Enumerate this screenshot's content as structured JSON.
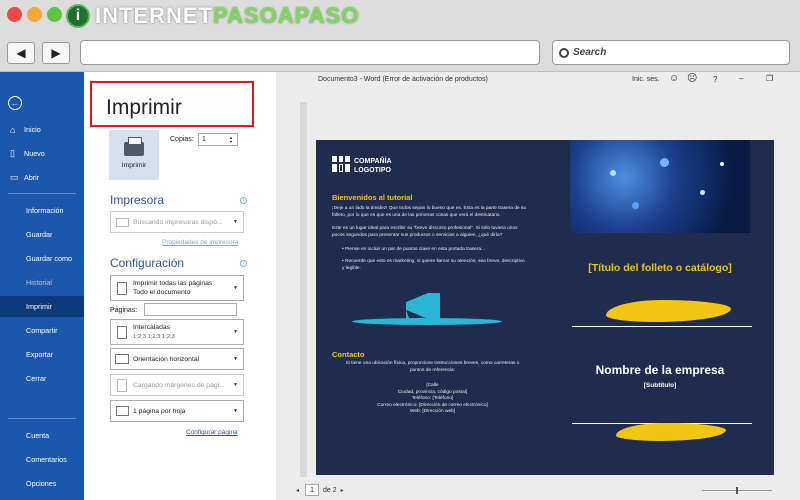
{
  "browser": {
    "logo_left": "INTERNET",
    "logo_right": "PASOAPASO",
    "back_icon": "arrow-left-icon",
    "forward_icon": "arrow-right-icon",
    "search_placeholder": "Search"
  },
  "window": {
    "title": "Documento3  -  Word (Error de activación de productos)",
    "signin": "Inic. ses.",
    "smile_icon": "☺",
    "frown_icon": "☹",
    "help": "?",
    "minimize": "–",
    "restore": "❐"
  },
  "sidebar": {
    "back_glyph": "←",
    "top_items": [
      {
        "icon": "⌂",
        "label": "Inicio"
      },
      {
        "icon": "▯",
        "label": "Nuevo"
      },
      {
        "icon": "▭",
        "label": "Abrir"
      }
    ],
    "items": [
      "Información",
      "Guardar",
      "Guardar como",
      "Historial",
      "Imprimir",
      "Compartir",
      "Exportar",
      "Cerrar"
    ],
    "bottom_items": [
      "Cuenta",
      "Comentarios",
      "Opciones"
    ]
  },
  "print": {
    "title": "Imprimir",
    "button_label": "Imprimir",
    "copies_label": "Copias:",
    "copies_value": "1",
    "printer_header": "Impresora",
    "printer_value": "Buscando impresoras dispo...",
    "printer_properties": "Propiedades de impresora",
    "settings_header": "Configuración",
    "pages_scope_line1": "Imprimir todas las páginas",
    "pages_scope_line2": "Todo el documento",
    "pages_label": "Páginas:",
    "collate_line1": "Intercaladas",
    "collate_line2": "1;2;3    1;2;3    1;2;3",
    "orientation": "Orientación horizontal",
    "margins": "Cargando márgenes de pági...",
    "pages_per_sheet": "1 página por hoja",
    "page_setup": "Configurar página",
    "info_glyph": "i"
  },
  "brochure": {
    "company_line1": "COMPAÑÍA",
    "company_line2": "LOGOTIPO",
    "welcome_heading": "Bienvenidos al tutorial",
    "para1": "¡Deje a un lado la timidez! Que todos sepan lo bueno que es. Esta es la parte trasera de su folleto, por lo que es que es una de las primeras cosas que verá el destinatario.",
    "para2": "Este es un lugar ideal para escribir su \"breve discurso profesional\". Si sólo tuviera unos pocos segundos para presentar sus productos o servicios a alguien, ¿qué diría?",
    "bullet1": "Piense en incluir un par de puntos clave en esta portada trasera...",
    "bullet2": "Recuerde que esto es marketing, si quiere llamar su atención, sea breve, descriptivo y legible.",
    "contact_heading": "Contacto",
    "contact_text": "Si tiene una ubicación física, proporcione instrucciones breves, como carreteras o puntos de referencia:",
    "address_lines": [
      "[Calle",
      "Ciudad, provincia, código postal]",
      "Teléfono: [Teléfono]",
      "Correo electrónico: [Dirección de correo electrónico]",
      "Web: [Dirección web]"
    ],
    "catalog_title": "[Título del folleto o catálogo]",
    "company_name": "Nombre de la empresa",
    "subtitle": "[Subtítulo]"
  },
  "pager": {
    "current": "1",
    "of_total": "de 2",
    "prev": "◂",
    "next": "▸"
  },
  "colors": {
    "sidebar": "#1b57ab",
    "sidebar_active": "#0d3a7a",
    "accent_blue": "#2b579a",
    "brochure_bg": "#1f2c4d",
    "brochure_yellow": "#f2c413",
    "brochure_teal": "#2bb6d4",
    "highlight_red": "#e01a1a"
  }
}
